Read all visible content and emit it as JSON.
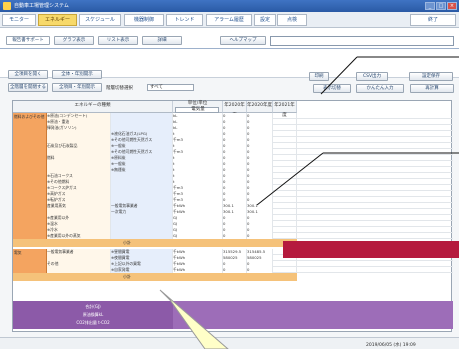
{
  "app": {
    "title": "自動車工場管理システム",
    "window_buttons": [
      "_",
      "□",
      "×"
    ]
  },
  "menu": {
    "items": [
      "モニター",
      "エネルギー",
      "スケジュール",
      "機器制御",
      "トレンド",
      "アラーム履歴",
      "設定",
      "点検"
    ],
    "end": "終了"
  },
  "tabs": {
    "items": [
      "報告書サポート",
      "グラフ表示",
      "リスト表示",
      "詳細",
      "ヘルプマップ"
    ]
  },
  "toolbar": {
    "left": [
      "全項目を開く",
      "全体・年別開示",
      "全階層を開閉する",
      "全項目・年別開示"
    ],
    "right": [
      "印刷",
      "CSV出力",
      "設定保存",
      "表示切替",
      "かんたん入力",
      "再計算"
    ],
    "scope_label": "階層切替選択",
    "scope_value": "すべて"
  },
  "grid": {
    "header": {
      "energy": "エネルギーの種類",
      "unit": "単位/単位",
      "unit_sub": "電気量",
      "y1": "年2020年度",
      "y2": "年2020年度",
      "y3": "年2021年度"
    },
    "groups": [
      {
        "name": "燃料およびその他",
        "rows": [
          {
            "a": "※原油(コンデンセート)",
            "b": "",
            "unit": "kL",
            "v1": "0",
            "v2": "0"
          },
          {
            "a": "※原油・重油",
            "b": "",
            "unit": "kL",
            "v1": "0",
            "v2": "0"
          },
          {
            "a": "揮発油(ガソリン)",
            "b": "",
            "unit": "kL",
            "v1": "0",
            "v2": "0"
          },
          {
            "a": "",
            "b": "※液化石油ガス(LPG)",
            "unit": "t",
            "v1": "0",
            "v2": "0"
          },
          {
            "a": "",
            "b": "※その他可燃性天然ガス",
            "unit": "千m3",
            "v1": "0",
            "v2": "0"
          },
          {
            "a": "石炭及び石炭製品",
            "b": "※一般炭",
            "unit": "t",
            "v1": "0",
            "v2": "0"
          },
          {
            "a": "",
            "b": "※その他可燃性天然ガス",
            "unit": "千m3",
            "v1": "0",
            "v2": "0"
          },
          {
            "a": "燃料",
            "b": "※原料炭",
            "unit": "t",
            "v1": "0",
            "v2": "0"
          },
          {
            "a": "",
            "b": "※一般炭",
            "unit": "t",
            "v1": "0",
            "v2": "0"
          },
          {
            "a": "",
            "b": "※無煙炭",
            "unit": "t",
            "v1": "0",
            "v2": "0"
          },
          {
            "a": "※石油コークス",
            "b": "",
            "unit": "t",
            "v1": "0",
            "v2": "0"
          },
          {
            "a": "※その他燃料",
            "b": "",
            "unit": "t",
            "v1": "0",
            "v2": "0"
          },
          {
            "a": "※コークス炉ガス",
            "b": "",
            "unit": "千m3",
            "v1": "0",
            "v2": "0"
          },
          {
            "a": "※高炉ガス",
            "b": "",
            "unit": "千m3",
            "v1": "0",
            "v2": "0"
          },
          {
            "a": "※転炉ガス",
            "b": "",
            "unit": "千m3",
            "v1": "0",
            "v2": "0"
          },
          {
            "a": "産業用蒸気",
            "b": "一般電気事業者",
            "unit": "千kWh",
            "v1": "300.1",
            "v2": "300.1"
          },
          {
            "a": "",
            "b": "一次電力",
            "unit": "千kWh",
            "v1": "300.1",
            "v2": "300.1"
          },
          {
            "a": "※産業用以外",
            "b": "",
            "unit": "GJ",
            "v1": "0",
            "v2": "0"
          },
          {
            "a": "※温水",
            "b": "",
            "unit": "GJ",
            "v1": "0",
            "v2": "0"
          },
          {
            "a": "※冷水",
            "b": "",
            "unit": "GJ",
            "v1": "0",
            "v2": "0"
          },
          {
            "a": "※産業用以外の蒸気",
            "b": "",
            "unit": "GJ",
            "v1": "0",
            "v2": "0"
          }
        ],
        "subtotal": "小計"
      },
      {
        "name": "電気",
        "rows": [
          {
            "a": "一般電気事業者",
            "b": "※昼間買電",
            "unit": "千kWh",
            "v1": "315529.5",
            "v2": "315485.5"
          },
          {
            "a": "",
            "b": "※夜間買電",
            "unit": "千kWh",
            "v1": "580025",
            "v2": "580025"
          },
          {
            "a": "その他",
            "b": "※上記以外の買電",
            "unit": "千kWh",
            "v1": "0",
            "v2": "0"
          },
          {
            "a": "",
            "b": "※自家発電",
            "unit": "千kWh",
            "v1": "0",
            "v2": "0"
          }
        ],
        "subtotal": "小計"
      }
    ],
    "footer": [
      "合計(GJ)",
      "原油換算kL",
      "CO2排出量 t-CO2"
    ]
  },
  "status": {
    "datetime": "2019/06/05 (水) 19:09"
  }
}
